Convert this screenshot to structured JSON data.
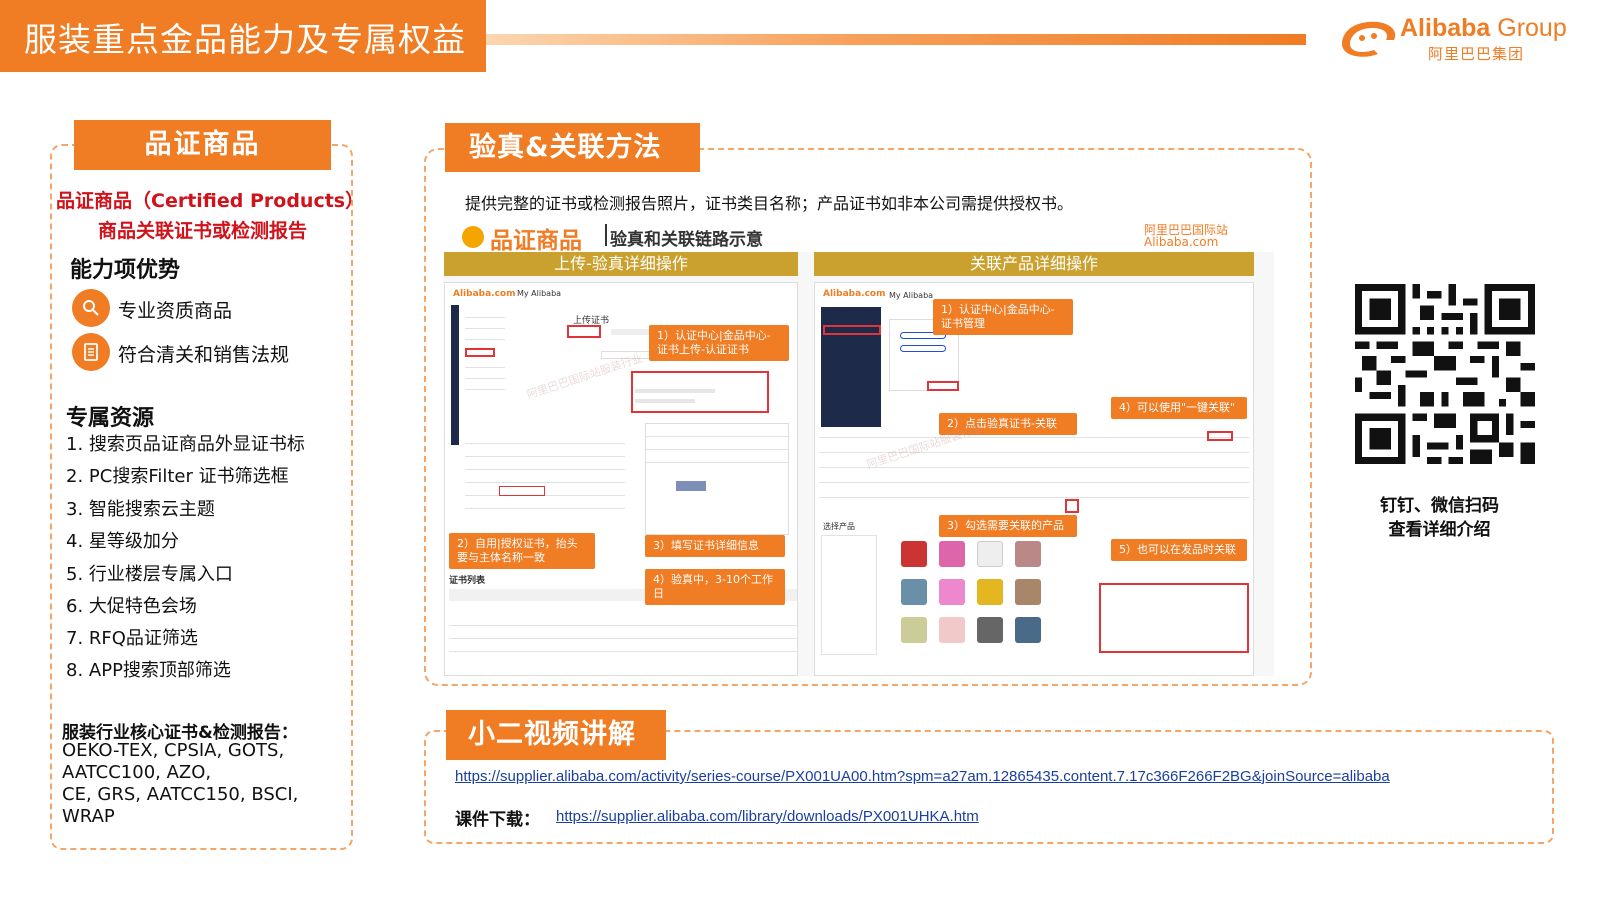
{
  "header": {
    "title": "服装重点金品能力及专属权益",
    "logo_text_bold": "Alibaba",
    "logo_text_light": " Group",
    "logo_cn": "阿里巴巴集团"
  },
  "left_panel": {
    "tab_label": "品证商品",
    "red_line1": "品证商品（Certified Products）",
    "red_line2": "商品关联证书或检测报告",
    "advantages_heading": "能力项优势",
    "advantages": [
      "专业资质商品",
      "符合清关和销售法规"
    ],
    "resources_heading": "专属资源",
    "resources": [
      "1. 搜索页品证商品外显证书标",
      "2. PC搜索Filter 证书筛选框",
      "3. 智能搜索云主题",
      "4. 星等级加分",
      "5. 行业楼层专属入口",
      "6. 大促特色会场",
      "7. RFQ品证筛选",
      "8. APP搜索顶部筛选"
    ],
    "core_heading": "服装行业核心证书&检测报告：",
    "core_lines": [
      "OEKO-TEX, CPSIA, GOTS,",
      "AATCC100, AZO,",
      "CE, GRS, AATCC150, BSCI,",
      "WRAP"
    ]
  },
  "middle_panel": {
    "tab_label": "验真&关联方法",
    "description": "提供完整的证书或检测报告照片，证书类目名称；产品证书如非本公司需提供授权书。",
    "screenshot": {
      "title_main": "品证商品",
      "title_sub": "验真和关联链路示意",
      "logo_cn": "阿里巴巴国际站",
      "logo_en": "Alibaba.com",
      "watermark": "阿里巴巴国际站服装行业",
      "left_bar": "上传-验真详细操作",
      "right_bar": "关联产品详细操作",
      "left_steps": [
        "1）认证中心|金品中心-证书上传-认证证书",
        "2）自用|授权证书，抬头要与主体名称一致",
        "3）填写证书详细信息",
        "4）验真中，3-10个工作日"
      ],
      "right_steps": [
        "1）认证中心|金品中心-证书管理",
        "2）点击验真证书-关联",
        "3）勾选需要关联的产品",
        "4）可以使用\"一键关联\"",
        "5）也可以在发品时关联"
      ],
      "mini_brand": "Alibaba.com",
      "mini_account": "My Alibaba",
      "mini_upload_label": "上传证书",
      "mini_list_label": "证书列表",
      "mini_products_label": "选择产品"
    }
  },
  "qr": {
    "caption_line1": "钉钉、微信扫码",
    "caption_line2": "查看详细介绍"
  },
  "bottom_panel": {
    "tab_label": "小二视频讲解",
    "video_url": "https://supplier.alibaba.com/activity/series-course/PX001UA00.htm?spm=a27am.12865435.content.7.17c366F266F2BG&joinSource=alibaba",
    "download_label": "课件下载：",
    "download_url": "https://supplier.alibaba.com/library/downloads/PX001UHKA.htm"
  },
  "colors": {
    "accent": "#f07c24",
    "red_text": "#d0121b",
    "gold_bar": "#caa12f",
    "link": "#1a3fa0"
  }
}
